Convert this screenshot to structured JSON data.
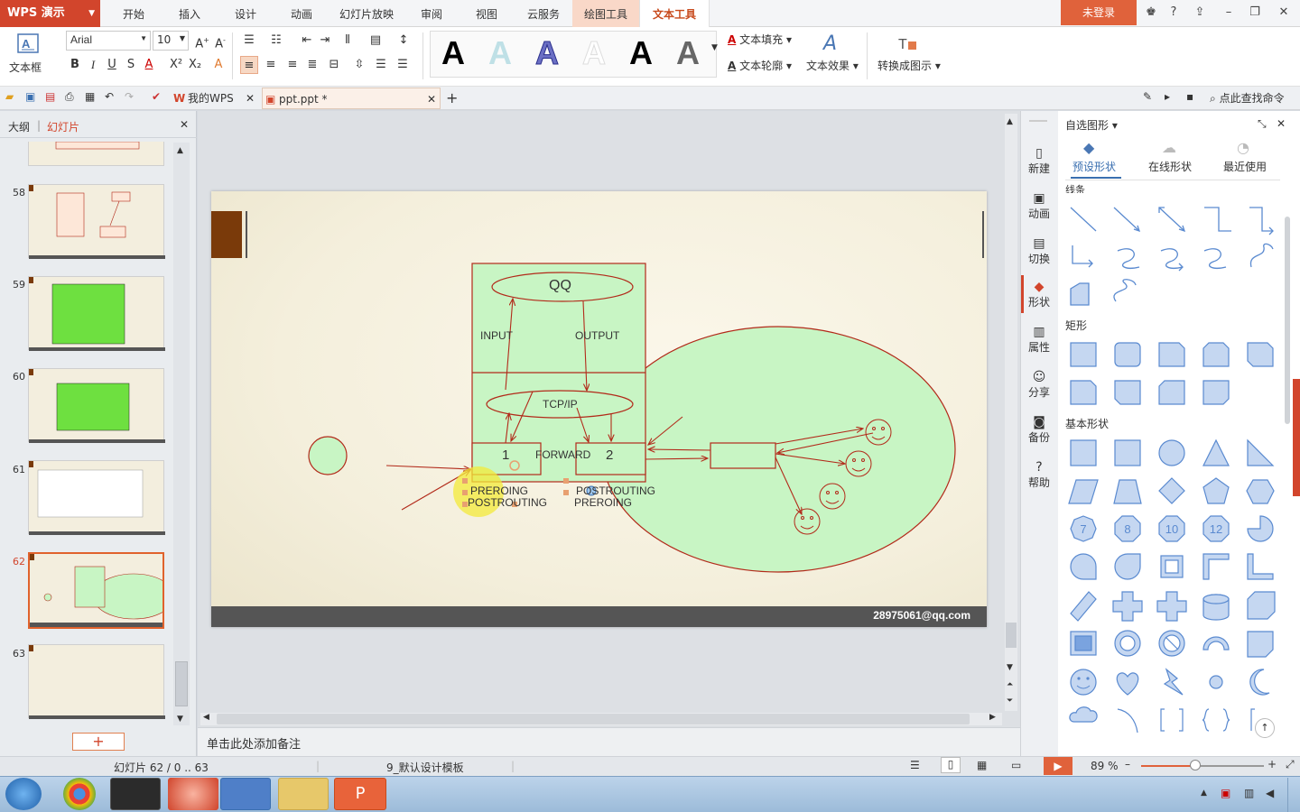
{
  "app": {
    "name": "WPS 演示",
    "login": "未登录"
  },
  "ribbon_tabs": [
    "开始",
    "插入",
    "设计",
    "动画",
    "幻灯片放映",
    "审阅",
    "视图",
    "云服务",
    "绘图工具",
    "文本工具"
  ],
  "ribbon": {
    "textbox_label": "文本框",
    "font_name": "Arial",
    "font_size": "10",
    "text_fill": "文本填充",
    "text_outline": "文本轮廓",
    "text_effect": "文本效果",
    "convert_label": "转换成图示"
  },
  "quick": {
    "search": "点此查找命令"
  },
  "doc_tabs": [
    {
      "label": "我的WPS"
    },
    {
      "label": "ppt.ppt *"
    }
  ],
  "left_panel": {
    "tab_outline": "大纲",
    "tab_slides": "幻灯片",
    "slides": [
      {
        "num": "58"
      },
      {
        "num": "59"
      },
      {
        "num": "60"
      },
      {
        "num": "61"
      },
      {
        "num": "62"
      },
      {
        "num": "63"
      }
    ]
  },
  "slide": {
    "qq": "QQ",
    "input": "INPUT",
    "output": "OUTPUT",
    "tcpip": "TCP/IP",
    "box1": "1",
    "forward": "FORWARD",
    "box2": "2",
    "left_pre": "PREROING",
    "left_post": "POSTROUTING",
    "right_post": "POSTROUTING",
    "right_pre": "PREROING",
    "email": "28975061@qq.com"
  },
  "notes_placeholder": "单击此处添加备注",
  "sidebar": [
    "新建",
    "动画",
    "切换",
    "形状",
    "属性",
    "分享",
    "备份",
    "帮助"
  ],
  "shape_panel": {
    "title": "自选图形",
    "tabs": [
      "预设形状",
      "在线形状",
      "最近使用"
    ],
    "sections": {
      "lines": "线条",
      "rect": "矩形",
      "basic": "基本形状"
    },
    "numbers": [
      "7",
      "8",
      "10",
      "12"
    ]
  },
  "status": {
    "slide_info": "幻灯片 62 / 0 .. 63",
    "template": "9_默认设计模板",
    "zoom": "89 %"
  },
  "colors": {
    "accent": "#d2452c",
    "slide_line": "#b22a1a",
    "slide_fill": "#c8f5c4"
  }
}
